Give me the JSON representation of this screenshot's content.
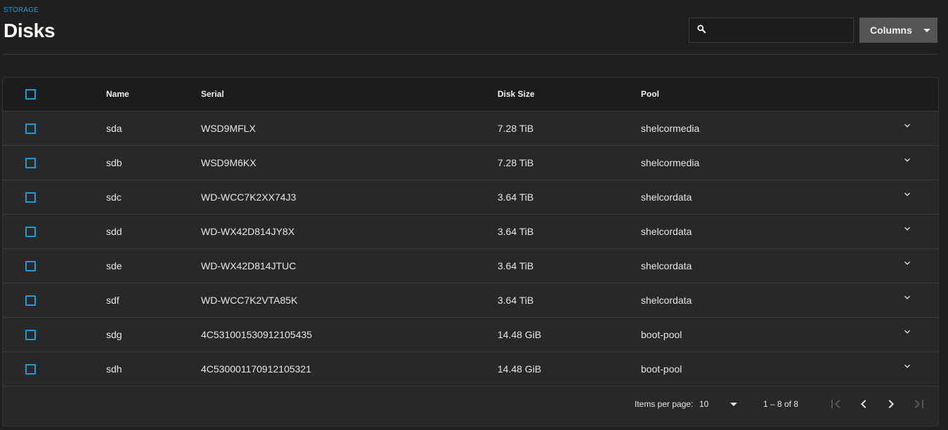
{
  "breadcrumb": "STORAGE",
  "title": "Disks",
  "search": {
    "placeholder": "",
    "value": ""
  },
  "columns_button": "Columns",
  "table": {
    "headers": {
      "name": "Name",
      "serial": "Serial",
      "size": "Disk Size",
      "pool": "Pool"
    },
    "rows": [
      {
        "name": "sda",
        "serial": "WSD9MFLX",
        "size": "7.28 TiB",
        "pool": "shelcormedia"
      },
      {
        "name": "sdb",
        "serial": "WSD9M6KX",
        "size": "7.28 TiB",
        "pool": "shelcormedia"
      },
      {
        "name": "sdc",
        "serial": "WD-WCC7K2XX74J3",
        "size": "3.64 TiB",
        "pool": "shelcordata"
      },
      {
        "name": "sdd",
        "serial": "WD-WX42D814JY8X",
        "size": "3.64 TiB",
        "pool": "shelcordata"
      },
      {
        "name": "sde",
        "serial": "WD-WX42D814JTUC",
        "size": "3.64 TiB",
        "pool": "shelcordata"
      },
      {
        "name": "sdf",
        "serial": "WD-WCC7K2VTA85K",
        "size": "3.64 TiB",
        "pool": "shelcordata"
      },
      {
        "name": "sdg",
        "serial": "4C531001530912105435",
        "size": "14.48 GiB",
        "pool": "boot-pool"
      },
      {
        "name": "sdh",
        "serial": "4C530001170912105321",
        "size": "14.48 GiB",
        "pool": "boot-pool"
      }
    ]
  },
  "paginator": {
    "items_per_page_label": "Items per page:",
    "items_per_page": "10",
    "range": "1 – 8 of 8"
  },
  "colors": {
    "accent": "#1e9bd7",
    "background": "#1f1f1f",
    "card": "#282828"
  },
  "icons": [
    "search-icon",
    "chevron-down-icon",
    "first-page-icon",
    "prev-page-icon",
    "next-page-icon",
    "last-page-icon"
  ]
}
